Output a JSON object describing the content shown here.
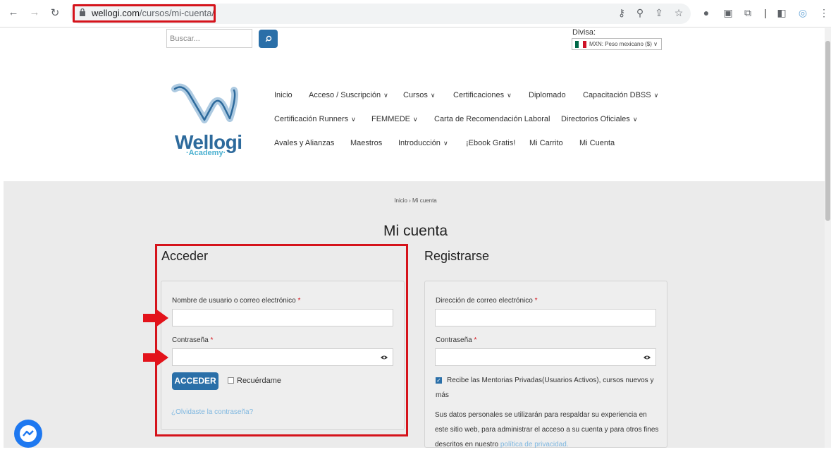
{
  "browser": {
    "url_domain": "wellogi.com",
    "url_path": "/cursos/mi-cuenta/"
  },
  "topbar": {
    "search_placeholder": "Buscar...",
    "currency_label": "Divisa:",
    "currency_value": "MXN: Peso mexicano ($)"
  },
  "logo": {
    "name": "Wellogi",
    "tagline": "·Academy·"
  },
  "menu": {
    "row1": [
      "Inicio",
      "Acceso / Suscripción",
      "Cursos",
      "Certificaciones",
      "Diplomado",
      "Capacitación DBSS"
    ],
    "row2": [
      "Certificación Runners",
      "FEMMEDE",
      "Carta de Recomendación Laboral",
      "Directorios Oficiales"
    ],
    "row3": [
      "Avales y Alianzas",
      "Maestros",
      "Introducción",
      "¡Ebook Gratis!",
      "Mi Carrito",
      "Mi Cuenta"
    ]
  },
  "breadcrumb": "Inicio › Mi cuenta",
  "page_title": "Mi cuenta",
  "login": {
    "title": "Acceder",
    "username_label": "Nombre de usuario o correo electrónico",
    "password_label": "Contraseña",
    "required_mark": "*",
    "submit_label": "ACCEDER",
    "remember_label": "Recuérdame",
    "lost_password": "¿Olvidaste la contraseña?"
  },
  "register": {
    "title": "Registrarse",
    "email_label": "Dirección de correo electrónico",
    "password_label": "Contraseña",
    "required_mark": "*",
    "newsletter_label": "Recibe las Mentorias Privadas(Usuarios Activos), cursos nuevos y más",
    "privacy_text": "Sus datos personales se utilizarán para respaldar su experiencia en este sitio web, para administrar el acceso a su cuenta y para otros fines descritos en nuestro",
    "privacy_link": "política de privacidad."
  },
  "colors": {
    "accent": "#2a6fa8",
    "highlight": "#d5131b",
    "link": "#7eb7e0"
  }
}
